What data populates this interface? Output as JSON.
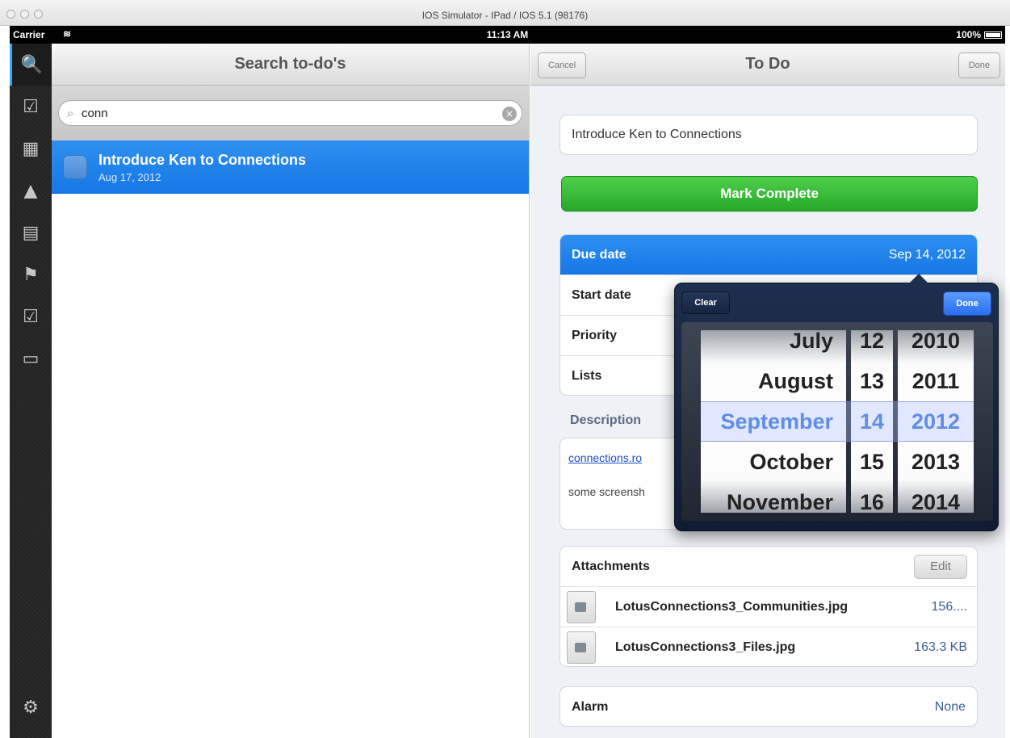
{
  "window": {
    "title": "IOS Simulator - IPad / IOS 5.1 (98176)"
  },
  "status_bar": {
    "carrier": "Carrier",
    "time": "11:13 AM",
    "battery": "100%"
  },
  "rail": {
    "items": [
      {
        "icon": "search-icon",
        "glyph": "🔍",
        "active": true
      },
      {
        "icon": "todo-check-icon",
        "glyph": "☑",
        "active": false
      },
      {
        "icon": "calendar-day-icon",
        "glyph": "▦",
        "active": false
      },
      {
        "icon": "warning-icon",
        "glyph": "▲",
        "active": false
      },
      {
        "icon": "calendar-icon",
        "glyph": "▤",
        "active": false
      },
      {
        "icon": "flag-icon",
        "glyph": "⚑",
        "active": false
      },
      {
        "icon": "completed-icon",
        "glyph": "☑",
        "active": false
      },
      {
        "icon": "inbox-icon",
        "glyph": "▭",
        "active": false
      }
    ],
    "settings_icon": "gear-icon"
  },
  "search": {
    "title": "Search to-do's",
    "query": "conn",
    "results": [
      {
        "title": "Introduce Ken to Connections",
        "date": "Aug 17, 2012"
      }
    ]
  },
  "detail": {
    "cancel_label": "Cancel",
    "title": "To Do",
    "done_label": "Done",
    "todo_title": "Introduce Ken to Connections",
    "mark_complete_label": "Mark Complete",
    "fields": [
      {
        "label": "Due date",
        "value": "Sep 14, 2012",
        "selected": true
      },
      {
        "label": "Start date",
        "value": "",
        "selected": false
      },
      {
        "label": "Priority",
        "value": "",
        "selected": false
      },
      {
        "label": "Lists",
        "value": "",
        "selected": false
      }
    ],
    "description_label": "Description",
    "description_link": "connections.ro",
    "description_text": "some screensh",
    "attachments_label": "Attachments",
    "attachments_edit_label": "Edit",
    "attachments": [
      {
        "name": "LotusConnections3_Communities.jpg",
        "size": "156...."
      },
      {
        "name": "LotusConnections3_Files.jpg",
        "size": "163.3 KB"
      }
    ],
    "alarm_label": "Alarm",
    "alarm_value": "None"
  },
  "date_picker": {
    "clear_label": "Clear",
    "done_label": "Done",
    "months": [
      "July",
      "August",
      "September",
      "October",
      "November"
    ],
    "days": [
      "12",
      "13",
      "14",
      "15",
      "16"
    ],
    "years": [
      "2010",
      "2011",
      "2012",
      "2013",
      "2014"
    ],
    "selected_index": 2
  }
}
